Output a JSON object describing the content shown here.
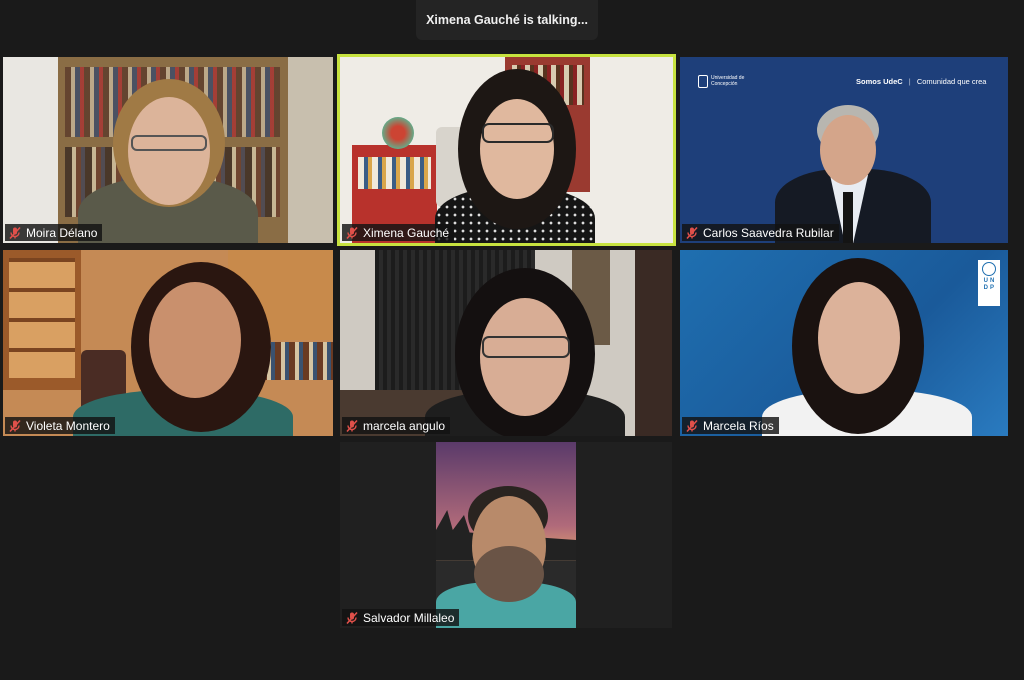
{
  "top_bar": {
    "talking_text": "Ximena Gauché is talking..."
  },
  "colors": {
    "background": "#1a1a1a",
    "active_speaker_border": "#c7e23f",
    "muted_icon": "#e0504a"
  },
  "participants": [
    {
      "name": "Moira Délano",
      "muted": true
    },
    {
      "name": "Ximena Gauché",
      "muted": true,
      "active_speaker": true
    },
    {
      "name": "Carlos Saavedra Rubilar",
      "muted": true,
      "banner": {
        "org": "Universidad de Concepción",
        "slogan_bold": "Somos UdeC",
        "slogan": "Comunidad que crea"
      }
    },
    {
      "name": "Violeta Montero",
      "muted": true
    },
    {
      "name": "marcela angulo",
      "muted": true
    },
    {
      "name": "Marcela Ríos",
      "muted": true,
      "logo": {
        "icon": "un-emblem-icon",
        "letters": [
          "U",
          "N",
          "D",
          "P"
        ]
      }
    },
    {
      "name": "Salvador Millaleo",
      "muted": true
    }
  ],
  "icons": {
    "mute": "muted-microphone-icon"
  }
}
